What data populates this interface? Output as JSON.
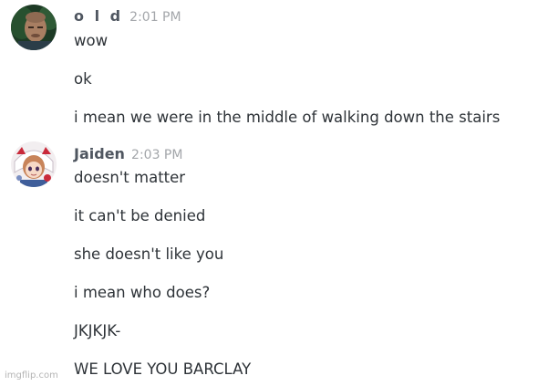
{
  "groups": [
    {
      "username": "o l d",
      "time": "2:01 PM",
      "avatar_icon": "old-man-avatar",
      "messages": [
        "wow",
        "ok",
        "i mean we were in the middle of walking down the stairs"
      ]
    },
    {
      "username": "Jaiden",
      "time": "2:03 PM",
      "avatar_icon": "anime-girl-avatar",
      "messages": [
        "doesn't matter",
        "it can't be denied",
        "she doesn't like you",
        "i mean who does?",
        "JKJKJK-",
        "WE LOVE YOU BARCLAY"
      ]
    }
  ],
  "watermark": "imgflip.com"
}
